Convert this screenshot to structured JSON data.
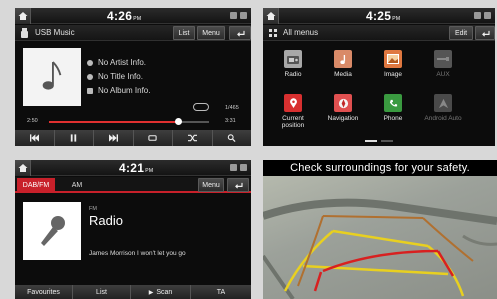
{
  "usb_music": {
    "clock": "4:26",
    "clock_ampm": "PM",
    "title": "USB Music",
    "list_btn": "List",
    "menu_btn": "Menu",
    "artist": "No Artist Info.",
    "song_title": "No Title Info.",
    "album": "No Album Info.",
    "track_counter": "1/465",
    "elapsed": "2:50",
    "total": "3:31",
    "progress": 0.81
  },
  "all_menus": {
    "clock": "4:25",
    "clock_ampm": "PM",
    "title": "All menus",
    "edit_btn": "Edit",
    "apps": [
      {
        "label": "Radio",
        "icon": "radio-icon",
        "color": "#a8a8a8"
      },
      {
        "label": "Media",
        "icon": "media-icon",
        "color": "#d98a68"
      },
      {
        "label": "Image",
        "icon": "image-icon",
        "color": "#e07840"
      },
      {
        "label": "AUX",
        "icon": "aux-icon",
        "color": "#555555"
      },
      {
        "label": "Current position",
        "icon": "location-pin-icon",
        "color": "#d83030"
      },
      {
        "label": "Navigation",
        "icon": "navigation-icon",
        "color": "#e05050"
      },
      {
        "label": "Phone",
        "icon": "phone-icon",
        "color": "#3a9a40"
      },
      {
        "label": "Android Auto",
        "icon": "android-auto-icon",
        "color": "#4a4a4a"
      }
    ]
  },
  "radio": {
    "clock": "4:21",
    "clock_ampm": "PM",
    "tab_dab": "DAB/FM",
    "tab_am": "AM",
    "menu_btn": "Menu",
    "band": "FM",
    "station": "Radio",
    "now_playing": "James Morrison I won't let you go",
    "favourites": "Favourites",
    "list": "List",
    "scan": "Scan",
    "ta": "TA"
  },
  "camera": {
    "banner": "Check surroundings for your safety."
  },
  "colors": {
    "accent_red": "#c8202a",
    "guide_yellow": "#e8d020",
    "guide_red": "#d82020"
  }
}
